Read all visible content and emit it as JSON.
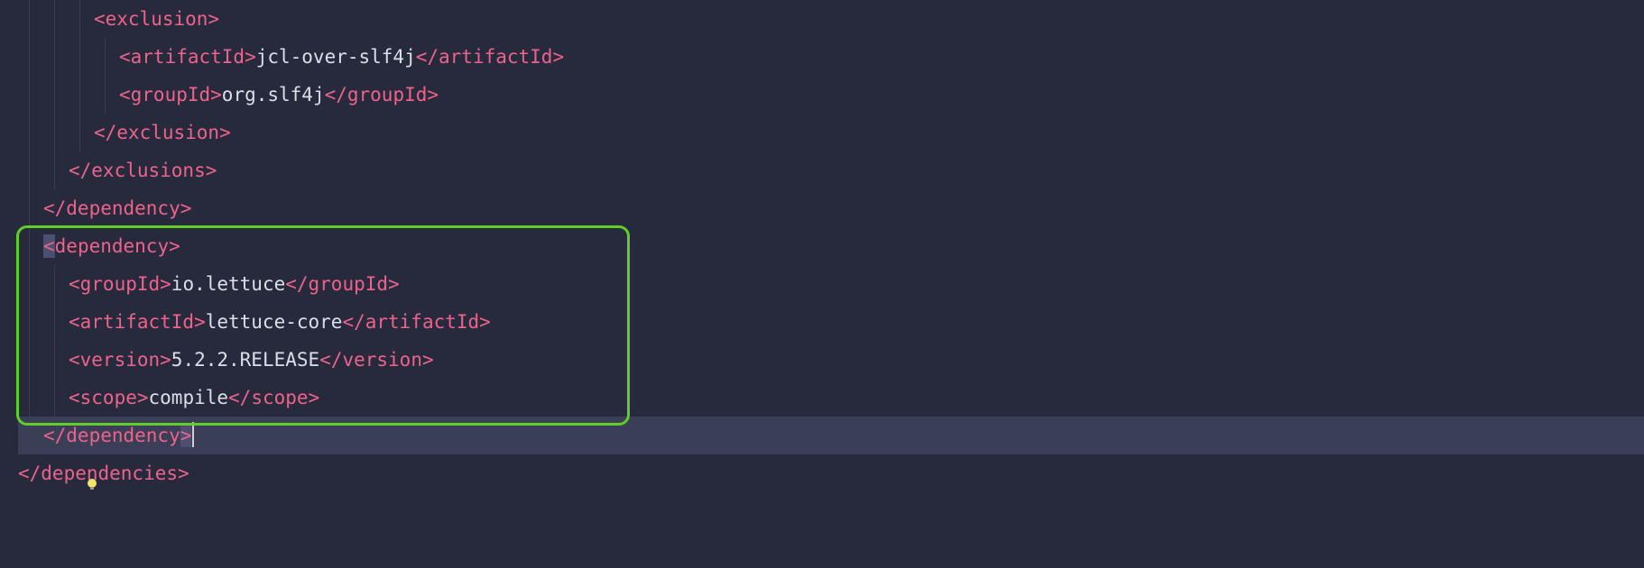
{
  "lines": {
    "l1": {
      "open": "<exclusion>"
    },
    "l2": {
      "open": "<artifactId>",
      "text": "jcl-over-slf4j",
      "close": "</artifactId>"
    },
    "l3": {
      "open": "<groupId>",
      "text": "org.slf4j",
      "close": "</groupId>"
    },
    "l4": {
      "close": "</exclusion>"
    },
    "l5": {
      "close": "</exclusions>"
    },
    "l6": {
      "close": "</dependency>"
    },
    "l7": {
      "open": "<dependency>"
    },
    "l8": {
      "open": "<groupId>",
      "text": "io.lettuce",
      "close": "</groupId>"
    },
    "l9": {
      "open": "<artifactId>",
      "text": "lettuce-core",
      "close": "</artifactId>"
    },
    "l10": {
      "open": "<version>",
      "text": "5.2.2.RELEASE",
      "close": "</version>"
    },
    "l11": {
      "open": "<scope>",
      "text": "compile",
      "close": "</scope>"
    },
    "l12": {
      "close": "</dependency>"
    },
    "l13": {
      "close": "</dependencies>"
    }
  },
  "highlight": {
    "color": "#5fce27"
  },
  "gutter": {
    "bulb": "intention-bulb-icon"
  }
}
